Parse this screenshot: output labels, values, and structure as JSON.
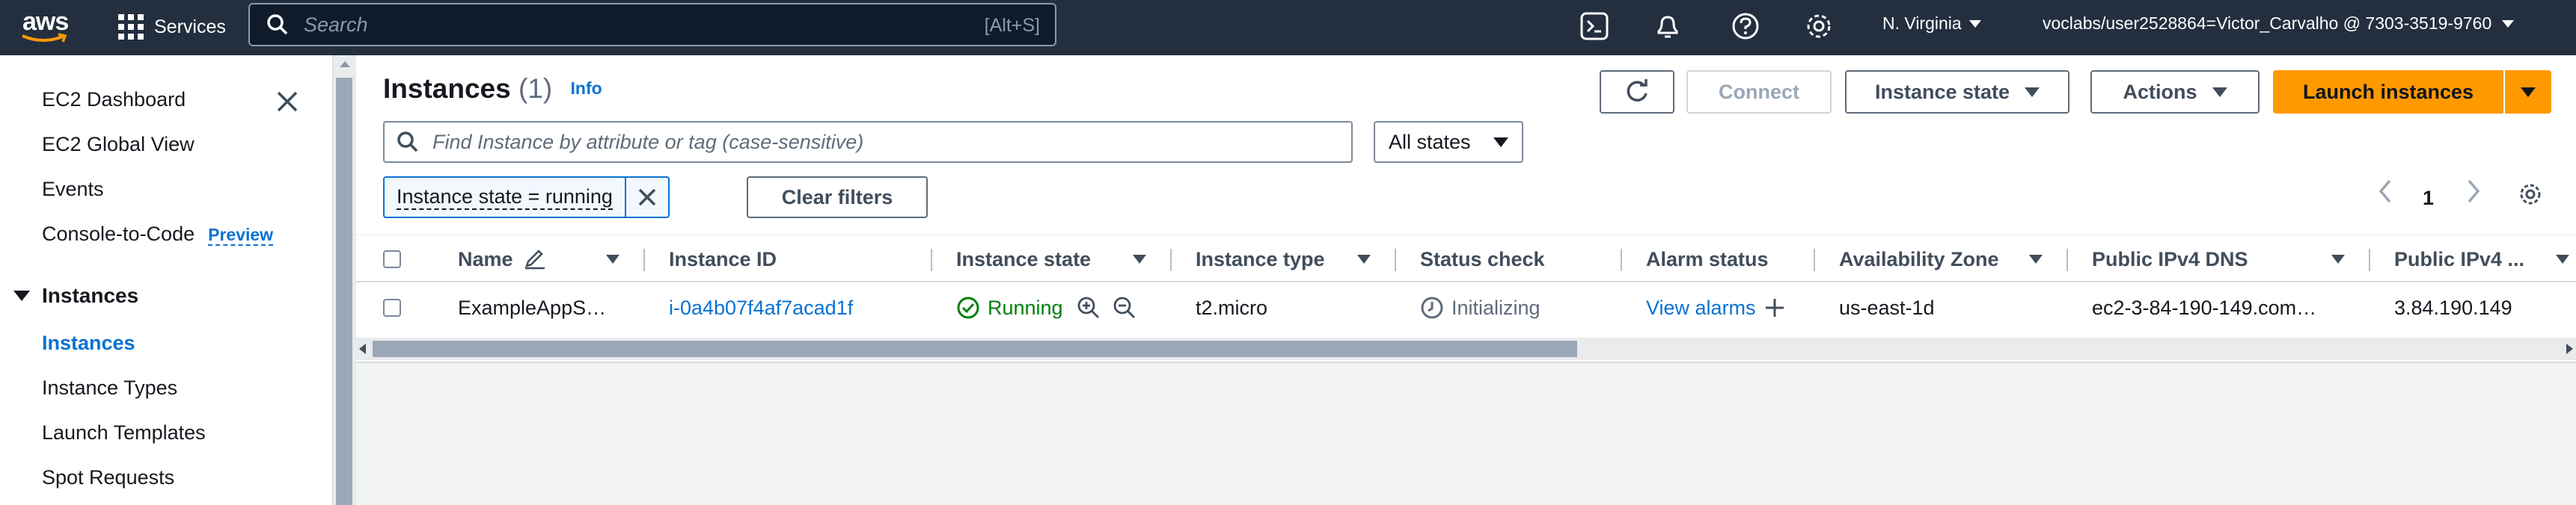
{
  "topnav": {
    "logo": "aws",
    "services_label": "Services",
    "search_placeholder": "Search",
    "search_shortcut": "[Alt+S]",
    "region": "N. Virginia",
    "account": "voclabs/user2528864=Victor_Carvalho @ 7303-3519-9760",
    "icons": [
      "cloudshell-icon",
      "bell-icon",
      "help-icon",
      "gear-icon"
    ]
  },
  "sidebar": {
    "items": [
      {
        "label": "EC2 Dashboard"
      },
      {
        "label": "EC2 Global View"
      },
      {
        "label": "Events"
      },
      {
        "label": "Console-to-Code",
        "badge": "Preview"
      }
    ],
    "section": "Instances",
    "section_items": [
      {
        "label": "Instances",
        "active": true
      },
      {
        "label": "Instance Types"
      },
      {
        "label": "Launch Templates"
      },
      {
        "label": "Spot Requests"
      }
    ]
  },
  "main": {
    "title": "Instances",
    "count": "(1)",
    "info": "Info",
    "buttons": {
      "connect": "Connect",
      "instance_state": "Instance state",
      "actions": "Actions",
      "launch": "Launch instances"
    },
    "filter_placeholder": "Find Instance by attribute or tag (case-sensitive)",
    "states_select": "All states",
    "token": "Instance state = running",
    "clear_filters": "Clear filters",
    "page": "1",
    "columns": [
      "Name",
      "Instance ID",
      "Instance state",
      "Instance type",
      "Status check",
      "Alarm status",
      "Availability Zone",
      "Public IPv4 DNS",
      "Public IPv4 ..."
    ],
    "rows": [
      {
        "name": "ExampleAppS…",
        "instance_id": "i-0a4b07f4af7acad1f",
        "state": "Running",
        "type": "t2.micro",
        "status_check": "Initializing",
        "alarm": "View alarms",
        "az": "us-east-1d",
        "dns": "ec2-3-84-190-149.com…",
        "ipv4": "3.84.190.149"
      }
    ]
  },
  "colors": {
    "nav_bg": "#232f3e",
    "link": "#0972d3",
    "primary": "#ff9900",
    "running": "#037f0c"
  }
}
